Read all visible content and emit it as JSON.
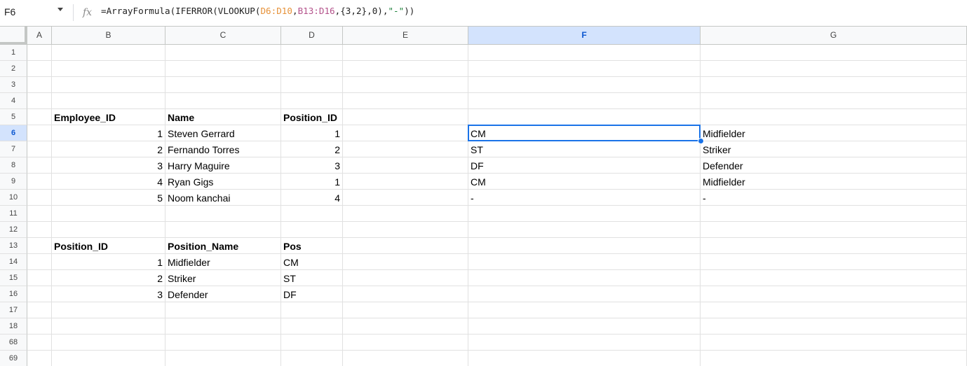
{
  "formula_bar": {
    "name_box": "F6",
    "fx_icon": "fx-icon",
    "formula_parts": [
      {
        "text": "=ArrayFormula(IFERROR(VLOOKUP(",
        "cls": ""
      },
      {
        "text": "D6:D10",
        "cls": "f-ref1"
      },
      {
        "text": ",",
        "cls": ""
      },
      {
        "text": "B13:D16",
        "cls": "f-ref2"
      },
      {
        "text": ",{3,2},0),",
        "cls": "f-num"
      },
      {
        "text": "\"-\"",
        "cls": "f-str"
      },
      {
        "text": "))",
        "cls": ""
      }
    ]
  },
  "columns": [
    "A",
    "B",
    "C",
    "D",
    "E",
    "F",
    "G"
  ],
  "active_column": "F",
  "row_labels": [
    "1",
    "2",
    "3",
    "4",
    "5",
    "6",
    "7",
    "8",
    "9",
    "10",
    "11",
    "12",
    "13",
    "14",
    "15",
    "16",
    "17",
    "18",
    "68",
    "69"
  ],
  "active_row": "6",
  "cells": [
    {
      "col": "B",
      "row": 4,
      "value": "Employee_ID",
      "bold": true
    },
    {
      "col": "C",
      "row": 4,
      "value": "Name",
      "bold": true
    },
    {
      "col": "D",
      "row": 4,
      "value": "Position_ID",
      "bold": true
    },
    {
      "col": "B",
      "row": 5,
      "value": "1",
      "num": true
    },
    {
      "col": "C",
      "row": 5,
      "value": "Steven Gerrard"
    },
    {
      "col": "D",
      "row": 5,
      "value": "1",
      "num": true
    },
    {
      "col": "F",
      "row": 5,
      "value": "CM"
    },
    {
      "col": "G",
      "row": 5,
      "value": "Midfielder"
    },
    {
      "col": "B",
      "row": 6,
      "value": "2",
      "num": true
    },
    {
      "col": "C",
      "row": 6,
      "value": "Fernando Torres"
    },
    {
      "col": "D",
      "row": 6,
      "value": "2",
      "num": true
    },
    {
      "col": "F",
      "row": 6,
      "value": "ST"
    },
    {
      "col": "G",
      "row": 6,
      "value": "Striker"
    },
    {
      "col": "B",
      "row": 7,
      "value": "3",
      "num": true
    },
    {
      "col": "C",
      "row": 7,
      "value": "Harry Maguire"
    },
    {
      "col": "D",
      "row": 7,
      "value": "3",
      "num": true
    },
    {
      "col": "F",
      "row": 7,
      "value": "DF"
    },
    {
      "col": "G",
      "row": 7,
      "value": "Defender"
    },
    {
      "col": "B",
      "row": 8,
      "value": "4",
      "num": true
    },
    {
      "col": "C",
      "row": 8,
      "value": "Ryan Gigs"
    },
    {
      "col": "D",
      "row": 8,
      "value": "1",
      "num": true
    },
    {
      "col": "F",
      "row": 8,
      "value": "CM"
    },
    {
      "col": "G",
      "row": 8,
      "value": "Midfielder"
    },
    {
      "col": "B",
      "row": 9,
      "value": "5",
      "num": true
    },
    {
      "col": "C",
      "row": 9,
      "value": "Noom kanchai"
    },
    {
      "col": "D",
      "row": 9,
      "value": "4",
      "num": true
    },
    {
      "col": "F",
      "row": 9,
      "value": "-"
    },
    {
      "col": "G",
      "row": 9,
      "value": "-"
    },
    {
      "col": "B",
      "row": 12,
      "value": "Position_ID",
      "bold": true
    },
    {
      "col": "C",
      "row": 12,
      "value": "Position_Name",
      "bold": true
    },
    {
      "col": "D",
      "row": 12,
      "value": "Pos",
      "bold": true
    },
    {
      "col": "B",
      "row": 13,
      "value": "1",
      "num": true
    },
    {
      "col": "C",
      "row": 13,
      "value": "Midfielder"
    },
    {
      "col": "D",
      "row": 13,
      "value": "CM"
    },
    {
      "col": "B",
      "row": 14,
      "value": "2",
      "num": true
    },
    {
      "col": "C",
      "row": 14,
      "value": "Striker"
    },
    {
      "col": "D",
      "row": 14,
      "value": "ST"
    },
    {
      "col": "B",
      "row": 15,
      "value": "3",
      "num": true
    },
    {
      "col": "C",
      "row": 15,
      "value": "Defender"
    },
    {
      "col": "D",
      "row": 15,
      "value": "DF"
    }
  ],
  "selection": {
    "col": "F",
    "row": 5
  },
  "colors": {
    "accent": "#1a73e8",
    "header_active_bg": "#d3e3fd",
    "header_active_text": "#0b57d0"
  }
}
